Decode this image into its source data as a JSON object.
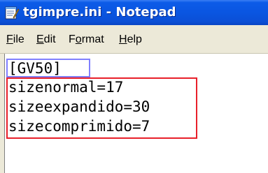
{
  "window": {
    "title": "tgimpre.ini - Notepad"
  },
  "menu": [
    {
      "label": "File",
      "underline": "F",
      "rest": "ile"
    },
    {
      "label": "Edit",
      "underline": "E",
      "rest": "dit"
    },
    {
      "label": "Format",
      "pre": "F",
      "underline": "o",
      "rest": "rmat"
    },
    {
      "label": "Help",
      "underline": "H",
      "rest": "elp"
    }
  ],
  "document": {
    "lines": [
      "[GV50]",
      "sizenormal=17",
      "sizeexpandido=30",
      "sizecomprimido=7"
    ]
  },
  "colors": {
    "titlebar": "#0a55e0",
    "menubar": "#ece9d8",
    "highlight_section": "#8080ff",
    "highlight_keys": "#e8202a"
  },
  "icons": {
    "app": "notepad-icon"
  }
}
